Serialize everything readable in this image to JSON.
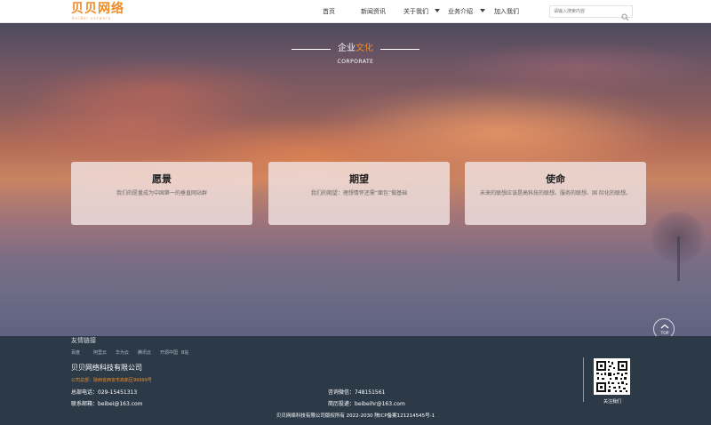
{
  "header": {
    "logo_cn": "贝贝网络",
    "logo_en": "BeiBei network",
    "nav": {
      "home": "首页",
      "news": "新闻资讯",
      "about": "关于我们",
      "business": "业务介绍",
      "join": "加入我们"
    },
    "search_placeholder": "请输入搜索内容"
  },
  "hero": {
    "title_main": "企业",
    "title_highlight": "文化",
    "subtitle": "CORPORATE",
    "cards": [
      {
        "title": "愿景",
        "desc": "我们的愿量成为中国第一的垂直网站群"
      },
      {
        "title": "期望",
        "desc": "我们的期望：理想情怀还需“面包”做基础"
      },
      {
        "title": "使命",
        "desc": "未来的联想应该是高科技的联想、服务的联想、国 际化的联想。"
      }
    ],
    "back_to_top": "TOP"
  },
  "footer": {
    "links_title": "友情链接",
    "links": [
      "百度",
      "阿里云",
      "华为云",
      "腾讯云",
      "开源中国",
      "B站"
    ],
    "company": "贝贝网络科技有限公司",
    "address": "公司总部：陕西省西安市高新区99999号",
    "phone_label": "总部电话：",
    "phone": "029-15451313",
    "email_label": "联系邮箱：",
    "email": "beibei@163.com",
    "wechat_label": "咨询微信：",
    "wechat": "748151561",
    "resume_label": "简历投递：",
    "resume": "beibeihr@163.com",
    "qr_label": "关注我们",
    "copyright": "贝贝网络科技有限公司版权所有 2022-2030 陕ICP备案121214545号-1"
  },
  "colors": {
    "accent": "#f08a24",
    "footer_bg": "#2c3a48"
  }
}
